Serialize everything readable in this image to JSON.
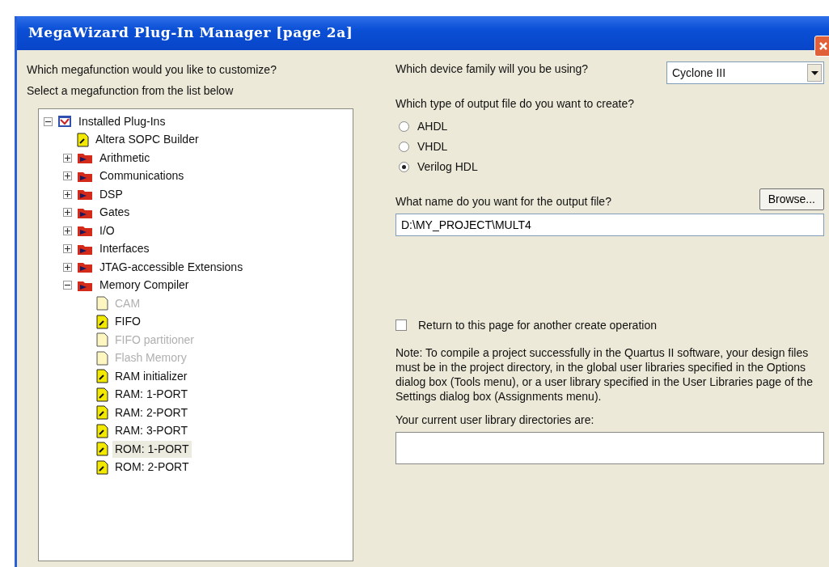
{
  "window": {
    "title": "MegaWizard Plug-In Manager [page 2a]"
  },
  "left": {
    "question": "Which megafunction would you like to customize?",
    "instruction": "Select a megafunction from the list below",
    "tree": [
      {
        "label": "Installed Plug-Ins",
        "kind": "root",
        "expanded": true,
        "selected": false,
        "disabled": false,
        "children": [
          {
            "label": "Altera SOPC Builder",
            "kind": "plugin",
            "selected": false,
            "disabled": false
          },
          {
            "label": "Arithmetic",
            "kind": "folder",
            "expanded": false,
            "selected": false,
            "disabled": false
          },
          {
            "label": "Communications",
            "kind": "folder",
            "expanded": false,
            "selected": false,
            "disabled": false
          },
          {
            "label": "DSP",
            "kind": "folder",
            "expanded": false,
            "selected": false,
            "disabled": false
          },
          {
            "label": "Gates",
            "kind": "folder",
            "expanded": false,
            "selected": false,
            "disabled": false
          },
          {
            "label": "I/O",
            "kind": "folder",
            "expanded": false,
            "selected": false,
            "disabled": false
          },
          {
            "label": "Interfaces",
            "kind": "folder",
            "expanded": false,
            "selected": false,
            "disabled": false
          },
          {
            "label": "JTAG-accessible Extensions",
            "kind": "folder",
            "expanded": false,
            "selected": false,
            "disabled": false
          },
          {
            "label": "Memory Compiler",
            "kind": "folder",
            "expanded": true,
            "selected": false,
            "disabled": false,
            "children": [
              {
                "label": "CAM",
                "kind": "plugin",
                "selected": false,
                "disabled": true
              },
              {
                "label": "FIFO",
                "kind": "plugin",
                "selected": false,
                "disabled": false
              },
              {
                "label": "FIFO partitioner",
                "kind": "plugin",
                "selected": false,
                "disabled": true
              },
              {
                "label": "Flash Memory",
                "kind": "plugin",
                "selected": false,
                "disabled": true
              },
              {
                "label": "RAM initializer",
                "kind": "plugin",
                "selected": false,
                "disabled": false
              },
              {
                "label": "RAM: 1-PORT",
                "kind": "plugin",
                "selected": false,
                "disabled": false
              },
              {
                "label": "RAM: 2-PORT",
                "kind": "plugin",
                "selected": false,
                "disabled": false
              },
              {
                "label": "RAM: 3-PORT",
                "kind": "plugin",
                "selected": false,
                "disabled": false
              },
              {
                "label": "ROM: 1-PORT",
                "kind": "plugin",
                "selected": true,
                "disabled": false
              },
              {
                "label": "ROM: 2-PORT",
                "kind": "plugin",
                "selected": false,
                "disabled": false
              }
            ]
          }
        ]
      }
    ]
  },
  "right": {
    "device_question": "Which device family will you be using?",
    "device_family": "Cyclone III",
    "output_type_question": "Which type of output file do you want to create?",
    "output_types": [
      {
        "label": "AHDL",
        "selected": false
      },
      {
        "label": "VHDL",
        "selected": false
      },
      {
        "label": "Verilog HDL",
        "selected": true
      }
    ],
    "name_question": "What name do you want for the output file?",
    "browse_button": "Browse...",
    "output_file": "D:\\MY_PROJECT\\MULT4",
    "return_checkbox": {
      "label": "Return to this page for another create operation",
      "checked": false
    },
    "note": "Note: To compile a project successfully in the Quartus II software, your design files must be in the project directory, in the global user libraries specified in the Options dialog box (Tools menu), or a user library specified in the User Libraries page of the Settings dialog box (Assignments menu).",
    "library_label": "Your current user library directories are:"
  }
}
